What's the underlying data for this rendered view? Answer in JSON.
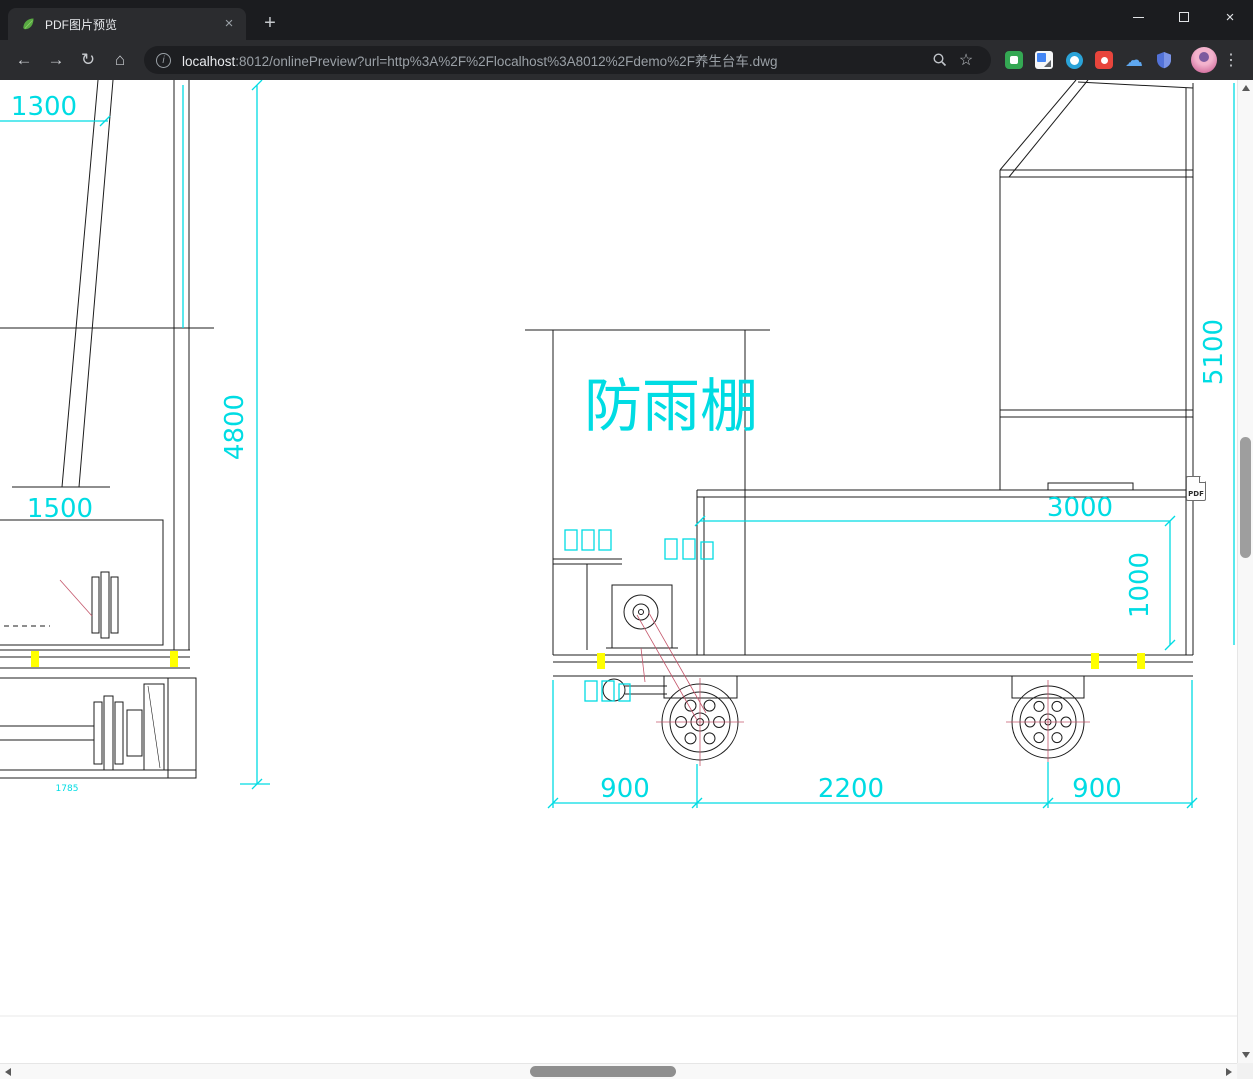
{
  "browser": {
    "tab": {
      "title": "PDF图片预览",
      "close_glyph": "×"
    },
    "new_tab_glyph": "+",
    "window_controls": {
      "close_glyph": "×"
    },
    "nav": {
      "back_glyph": "←",
      "forward_glyph": "→",
      "reload_glyph": "↻",
      "home_glyph": "⌂",
      "info_glyph": "i",
      "star_glyph": "☆",
      "menu_glyph": "⋮",
      "cloud_glyph": "☁"
    },
    "omnibox": {
      "url_host": "localhost",
      "url_rest": ":8012/onlinePreview?url=http%3A%2F%2Flocalhost%3A8012%2Fdemo%2F养生台车.dwg"
    }
  },
  "viewer": {
    "pdf_badge": "PDF"
  },
  "drawing": {
    "shelter_label": "防雨棚",
    "dims": {
      "top_left_width": "1300",
      "left_height": "4800",
      "left_width": "1500",
      "left_small": "1785",
      "right_height": "5100",
      "beam_length": "3000",
      "beam_drop": "1000",
      "front_overhang": "900",
      "wheelbase": "2200",
      "rear_overhang": "900"
    },
    "colors": {
      "dimension": "#00dce3",
      "highlight": "#ffff00",
      "line": "#1c1c1c",
      "construction": "#c4566b"
    }
  }
}
